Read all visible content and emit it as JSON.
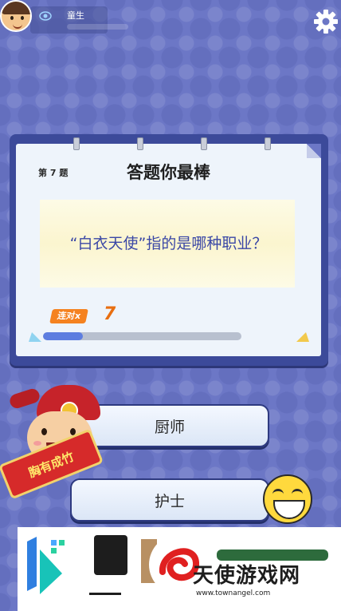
{
  "header": {
    "user_name": "童生",
    "icons": {
      "avatar": "player-avatar",
      "rank": "eye-rank-icon",
      "settings": "gear-icon"
    }
  },
  "question_card": {
    "number_label": "第 7 题",
    "title": "答题你最棒",
    "question": "“白衣天使”指的是哪种职业？",
    "combo_label": "连对x",
    "combo_count": "7",
    "progress_fraction": 0.2
  },
  "options": [
    {
      "label": "厨师"
    },
    {
      "label": "护士"
    }
  ],
  "mascot": {
    "banner_text": "胸有成竹"
  },
  "watermark": {
    "brand": "天使游戏网",
    "url": "www.townangel.com"
  },
  "colors": {
    "background": "#6c77c6",
    "board": "#3c4a9a",
    "question_text": "#3a47a6",
    "combo_orange": "#f58220",
    "progress_fill": "#5d7de0"
  }
}
